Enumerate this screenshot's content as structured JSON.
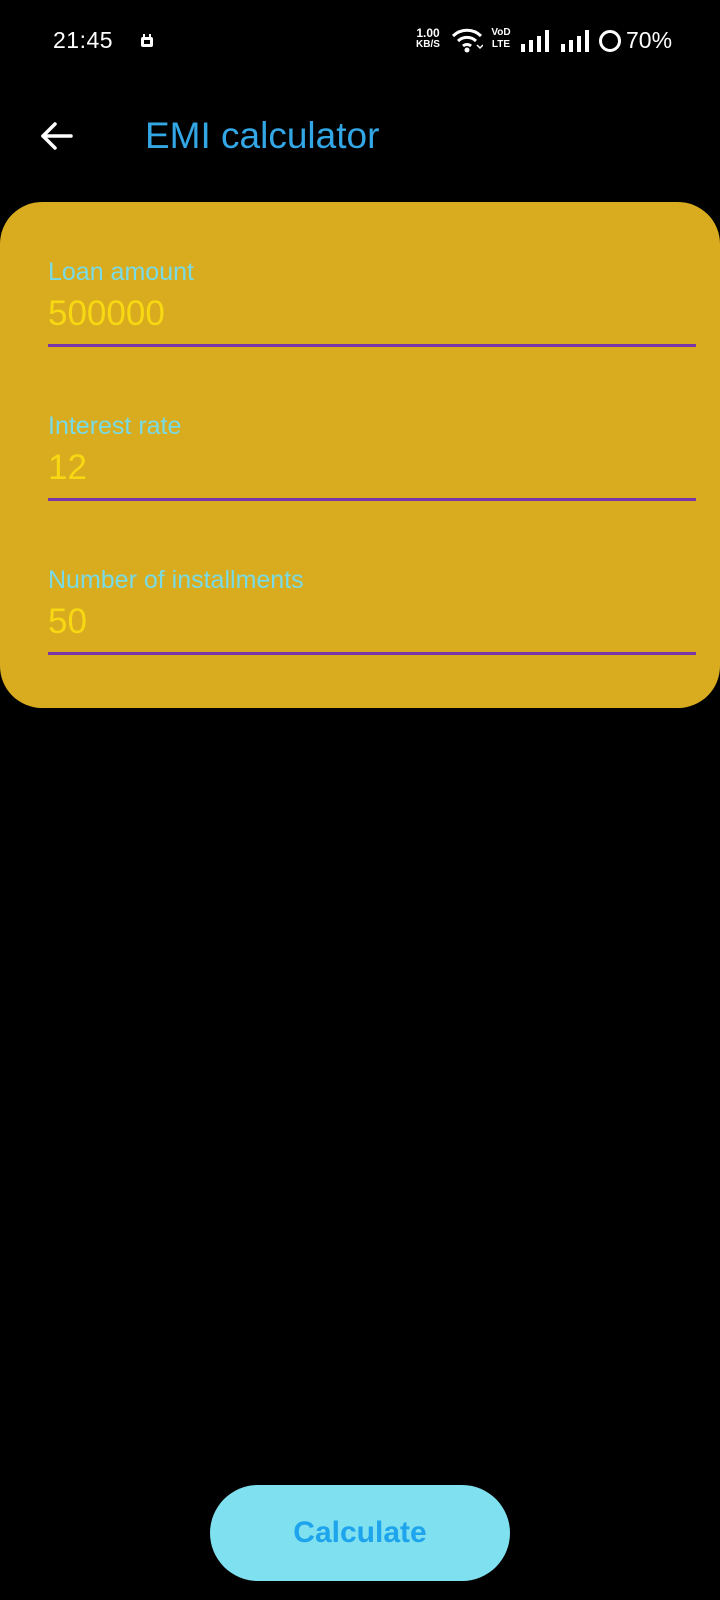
{
  "status_bar": {
    "time": "21:45",
    "notification_icon": "notification-icon",
    "net_speed_value": "1.00",
    "net_speed_unit": "KB/S",
    "wifi_icon": "wifi-icon",
    "volte_top": "VoD",
    "volte_bottom": "LTE",
    "signal_icon": "signal-icon",
    "battery_percent": "70%"
  },
  "toolbar": {
    "back_icon": "arrow-back-icon",
    "title": "EMI calculator"
  },
  "form": {
    "fields": [
      {
        "label": "Loan amount",
        "value": "500000"
      },
      {
        "label": "Interest rate",
        "value": "12"
      },
      {
        "label": "Number of installments",
        "value": "50"
      }
    ]
  },
  "actions": {
    "calculate_label": "Calculate"
  },
  "colors": {
    "background": "#000000",
    "card": "#d9ab1e",
    "title": "#33a7e6",
    "label": "#79dbe6",
    "value": "#f7d813",
    "underline": "#7a35a8",
    "button_bg": "#7fe0ef",
    "button_text": "#1ea4ec"
  }
}
